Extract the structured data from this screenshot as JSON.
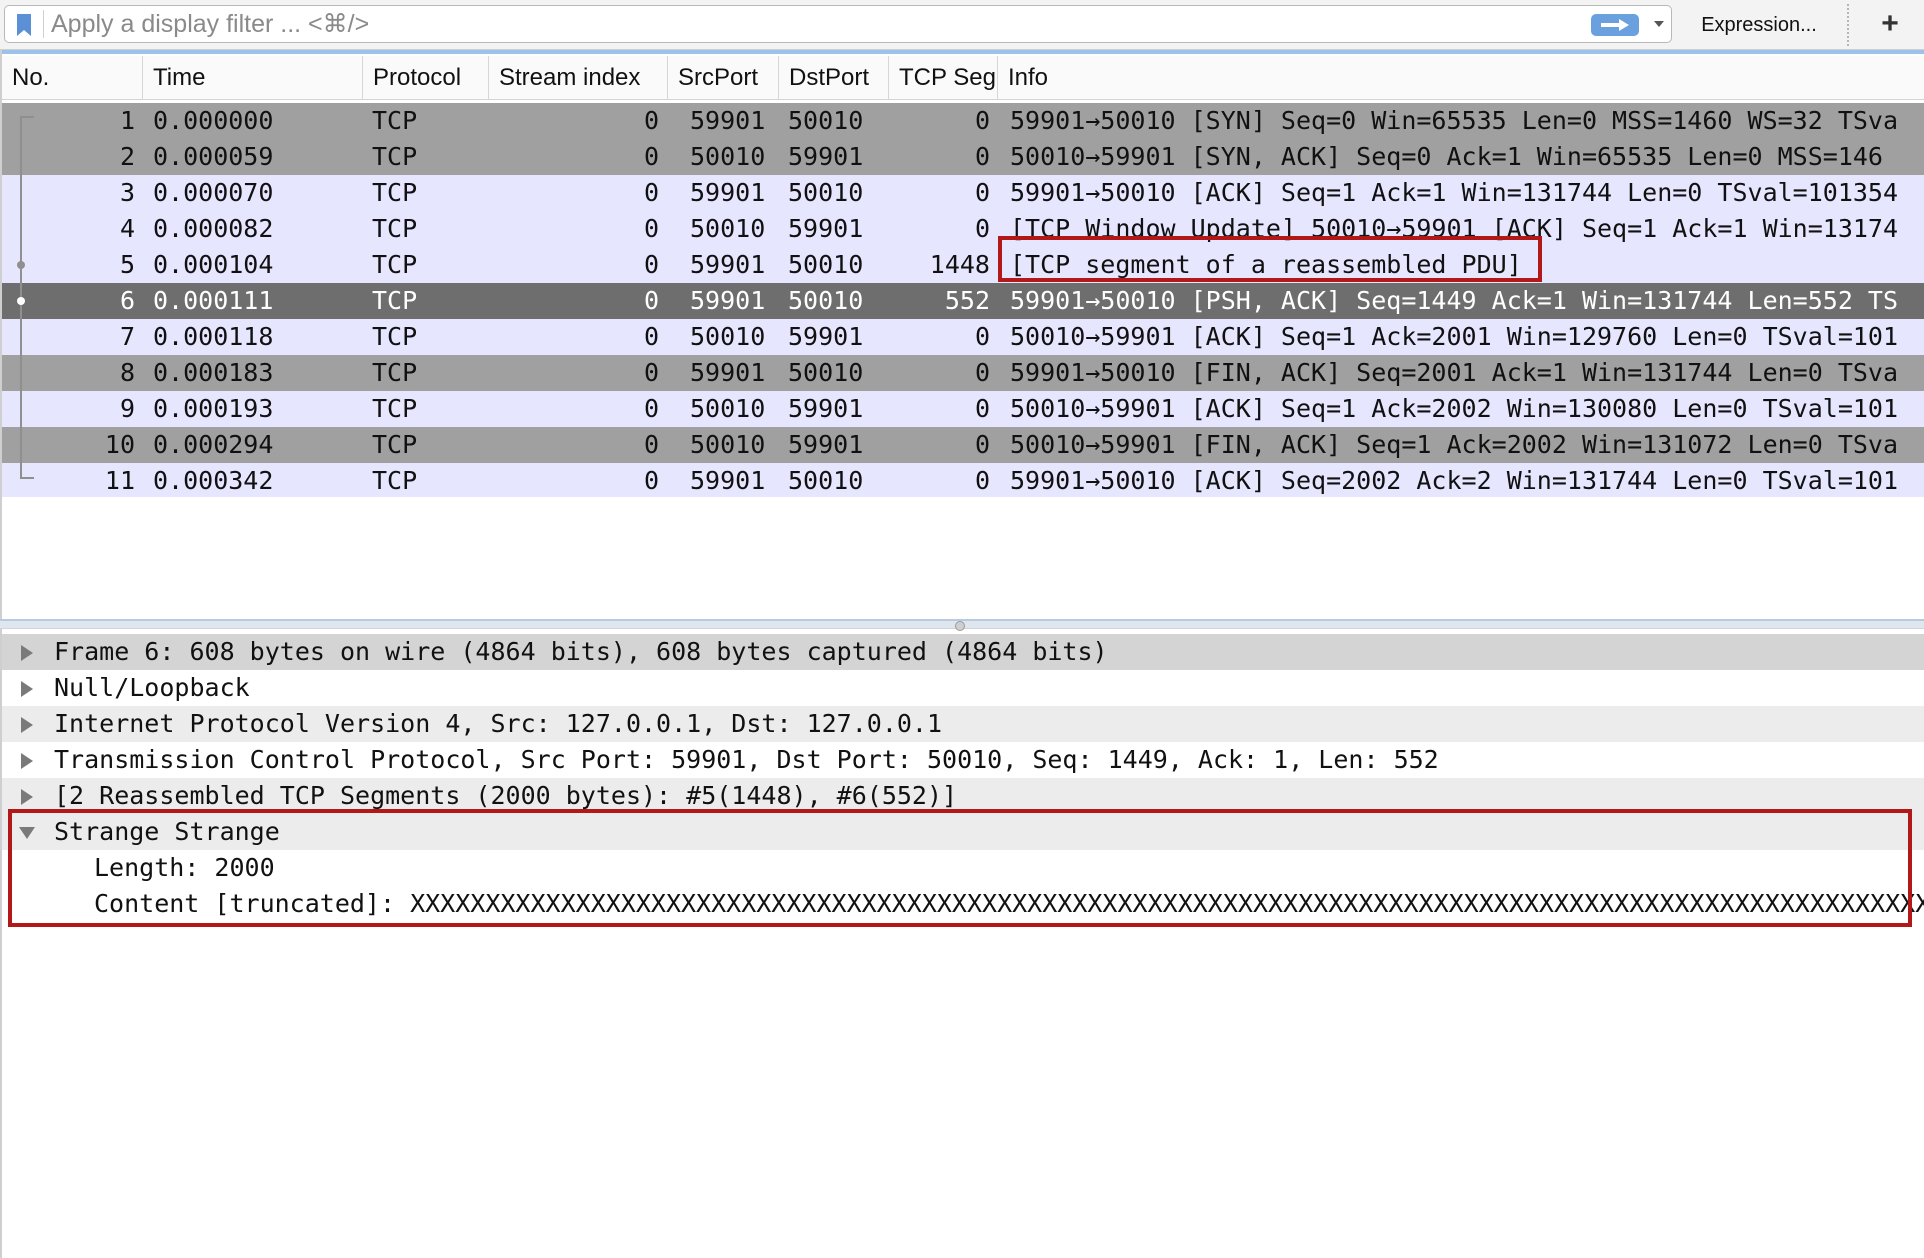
{
  "filter": {
    "placeholder": "Apply a display filter ... <⌘/>",
    "value": "",
    "expression_label": "Expression...",
    "add_label": "+"
  },
  "columns": [
    "No.",
    "Time",
    "Protocol",
    "Stream index",
    "SrcPort",
    "DstPort",
    "TCP Seg",
    "Info"
  ],
  "packets": [
    {
      "no": "1",
      "time": "0.000000",
      "protocol": "TCP",
      "stream": "0",
      "src": "59901",
      "dst": "50010",
      "seg": "0",
      "info": "59901→50010 [SYN] Seq=0 Win=65535 Len=0 MSS=1460 WS=32 TSva",
      "style": "grey"
    },
    {
      "no": "2",
      "time": "0.000059",
      "protocol": "TCP",
      "stream": "0",
      "src": "50010",
      "dst": "59901",
      "seg": "0",
      "info": "50010→59901 [SYN, ACK] Seq=0 Ack=1 Win=65535 Len=0 MSS=146",
      "style": "grey"
    },
    {
      "no": "3",
      "time": "0.000070",
      "protocol": "TCP",
      "stream": "0",
      "src": "59901",
      "dst": "50010",
      "seg": "0",
      "info": "59901→50010 [ACK] Seq=1 Ack=1 Win=131744 Len=0 TSval=101354",
      "style": "lav"
    },
    {
      "no": "4",
      "time": "0.000082",
      "protocol": "TCP",
      "stream": "0",
      "src": "50010",
      "dst": "59901",
      "seg": "0",
      "info": "[TCP Window Update] 50010→59901 [ACK] Seq=1 Ack=1 Win=13174",
      "style": "lav"
    },
    {
      "no": "5",
      "time": "0.000104",
      "protocol": "TCP",
      "stream": "0",
      "src": "59901",
      "dst": "50010",
      "seg": "1448",
      "info": "[TCP segment of a reassembled PDU]",
      "style": "lav"
    },
    {
      "no": "6",
      "time": "0.000111",
      "protocol": "TCP",
      "stream": "0",
      "src": "59901",
      "dst": "50010",
      "seg": "552",
      "info": "59901→50010 [PSH, ACK] Seq=1449 Ack=1 Win=131744 Len=552 TS",
      "style": "sel"
    },
    {
      "no": "7",
      "time": "0.000118",
      "protocol": "TCP",
      "stream": "0",
      "src": "50010",
      "dst": "59901",
      "seg": "0",
      "info": "50010→59901 [ACK] Seq=1 Ack=2001 Win=129760 Len=0 TSval=101",
      "style": "lav"
    },
    {
      "no": "8",
      "time": "0.000183",
      "protocol": "TCP",
      "stream": "0",
      "src": "59901",
      "dst": "50010",
      "seg": "0",
      "info": "59901→50010 [FIN, ACK] Seq=2001 Ack=1 Win=131744 Len=0 TSva",
      "style": "grey"
    },
    {
      "no": "9",
      "time": "0.000193",
      "protocol": "TCP",
      "stream": "0",
      "src": "50010",
      "dst": "59901",
      "seg": "0",
      "info": "50010→59901 [ACK] Seq=1 Ack=2002 Win=130080 Len=0 TSval=101",
      "style": "lav"
    },
    {
      "no": "10",
      "time": "0.000294",
      "protocol": "TCP",
      "stream": "0",
      "src": "50010",
      "dst": "59901",
      "seg": "0",
      "info": "50010→59901 [FIN, ACK] Seq=1 Ack=2002 Win=131072 Len=0 TSva",
      "style": "grey"
    },
    {
      "no": "11",
      "time": "0.000342",
      "protocol": "TCP",
      "stream": "0",
      "src": "59901",
      "dst": "50010",
      "seg": "0",
      "info": "59901→50010 [ACK] Seq=2002 Ack=2 Win=131744 Len=0 TSval=101",
      "style": "lav"
    }
  ],
  "details": [
    {
      "text": "Frame 6: 608 bytes on wire (4864 bits), 608 bytes captured (4864 bits)",
      "expanded": false,
      "style": "sel"
    },
    {
      "text": "Null/Loopback",
      "expanded": false,
      "style": "plain"
    },
    {
      "text": "Internet Protocol Version 4, Src: 127.0.0.1, Dst: 127.0.0.1",
      "expanded": false,
      "style": "alt"
    },
    {
      "text": "Transmission Control Protocol, Src Port: 59901, Dst Port: 50010, Seq: 1449, Ack: 1, Len: 552",
      "expanded": false,
      "style": "plain"
    },
    {
      "text": "[2 Reassembled TCP Segments (2000 bytes): #5(1448), #6(552)]",
      "expanded": false,
      "style": "alt"
    },
    {
      "text": "Strange Strange",
      "expanded": true,
      "style": "alt",
      "children": [
        "Length: 2000",
        "Content [truncated]: XXXXXXXXXXXXXXXXXXXXXXXXXXXXXXXXXXXXXXXXXXXXXXXXXXXXXXXXXXXXXXXXXXXXXXXXXXXXXXXXXXXXXXXXXXXXXXXXXXXXXXXXXXXXXXXXXXXXXXX"
      ]
    }
  ],
  "colors": {
    "highlight_border": "#b21818",
    "selected_row": "#6e6e6e",
    "grey_row": "#a0a0a0",
    "lavender_row": "#e7e6ff"
  }
}
